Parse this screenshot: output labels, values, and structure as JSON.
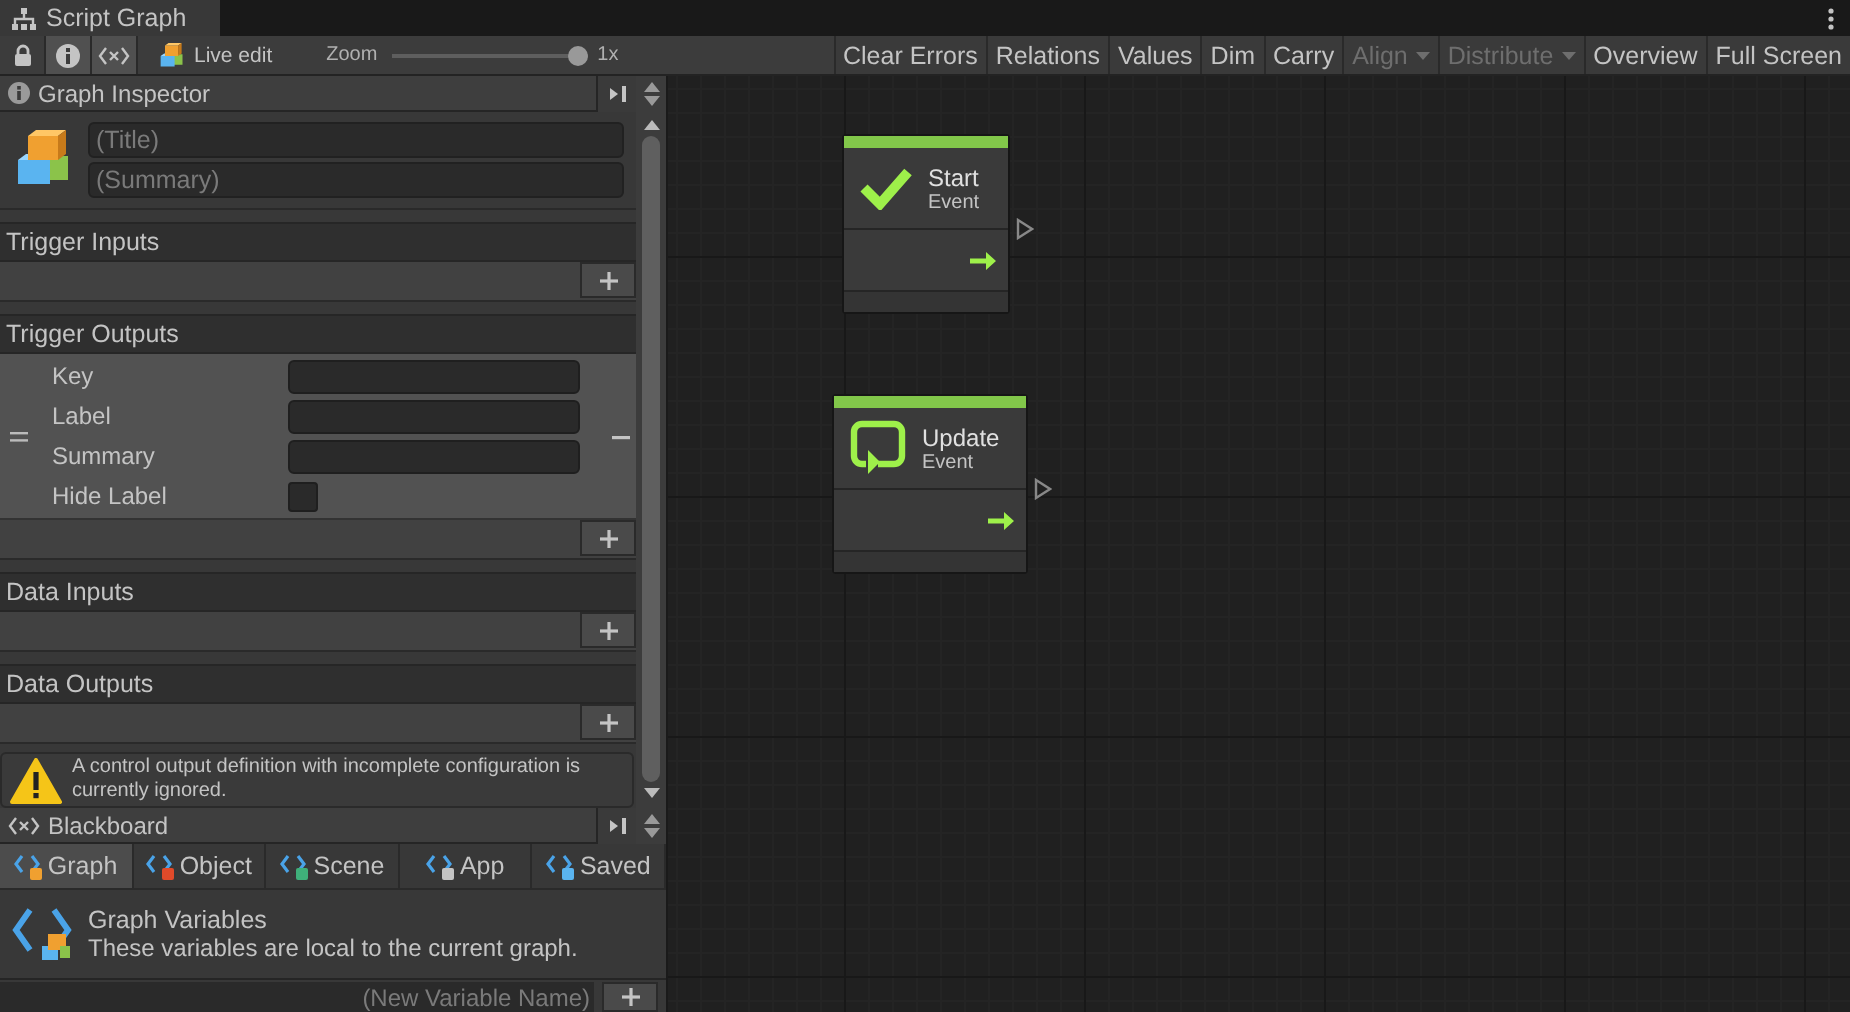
{
  "window": {
    "tab_title": "Script Graph"
  },
  "toolbar": {
    "toggles": [
      {
        "kind": "lock",
        "selected": false
      },
      {
        "kind": "info",
        "selected": true
      },
      {
        "kind": "variables",
        "selected": true
      }
    ],
    "live_edit": "Live edit",
    "zoom_label": "Zoom",
    "zoom": {
      "level": 1.0
    },
    "zoom_reading": "1x",
    "buttons": [
      {
        "label": "Clear Errors",
        "disabled": false,
        "dropdown": false
      },
      {
        "label": "Relations",
        "disabled": false,
        "dropdown": false
      },
      {
        "label": "Values",
        "disabled": false,
        "dropdown": false
      },
      {
        "label": "Dim",
        "disabled": false,
        "dropdown": false
      },
      {
        "label": "Carry",
        "disabled": false,
        "dropdown": false
      },
      {
        "label": "Align",
        "disabled": true,
        "dropdown": true
      },
      {
        "label": "Distribute",
        "disabled": true,
        "dropdown": true
      },
      {
        "label": "Overview",
        "disabled": false,
        "dropdown": false
      },
      {
        "label": "Full Screen",
        "disabled": false,
        "dropdown": false
      }
    ]
  },
  "inspector": {
    "title": "Graph Inspector",
    "title_placeholder": "(Title)",
    "summary_placeholder": "(Summary)",
    "sections": [
      {
        "title": "Trigger Inputs"
      },
      {
        "title": "Trigger Outputs",
        "items": [
          {
            "fields": [
              {
                "label": "Key",
                "kind": "text"
              },
              {
                "label": "Label",
                "kind": "text"
              },
              {
                "label": "Summary",
                "kind": "text"
              },
              {
                "label": "Hide Label",
                "kind": "checkbox",
                "checked": false
              }
            ]
          }
        ]
      },
      {
        "title": "Data Inputs"
      },
      {
        "title": "Data Outputs"
      }
    ],
    "warning": "A control output definition with incomplete configuration is currently ignored."
  },
  "blackboard": {
    "title": "Blackboard",
    "tabs": [
      {
        "label": "Graph",
        "kind": "graph",
        "selected": true
      },
      {
        "label": "Object",
        "kind": "object",
        "selected": false
      },
      {
        "label": "Scene",
        "kind": "scene",
        "selected": false
      },
      {
        "label": "App",
        "kind": "app",
        "selected": false
      },
      {
        "label": "Saved",
        "kind": "saved",
        "selected": false
      }
    ],
    "heading": "Graph Variables",
    "description": "These variables are local to the current graph.",
    "new_variable_placeholder": "(New Variable Name)"
  },
  "nodes": [
    {
      "title": "Start",
      "subtitle": "Event",
      "kind": "start"
    },
    {
      "title": "Update",
      "subtitle": "Event",
      "kind": "update"
    }
  ]
}
